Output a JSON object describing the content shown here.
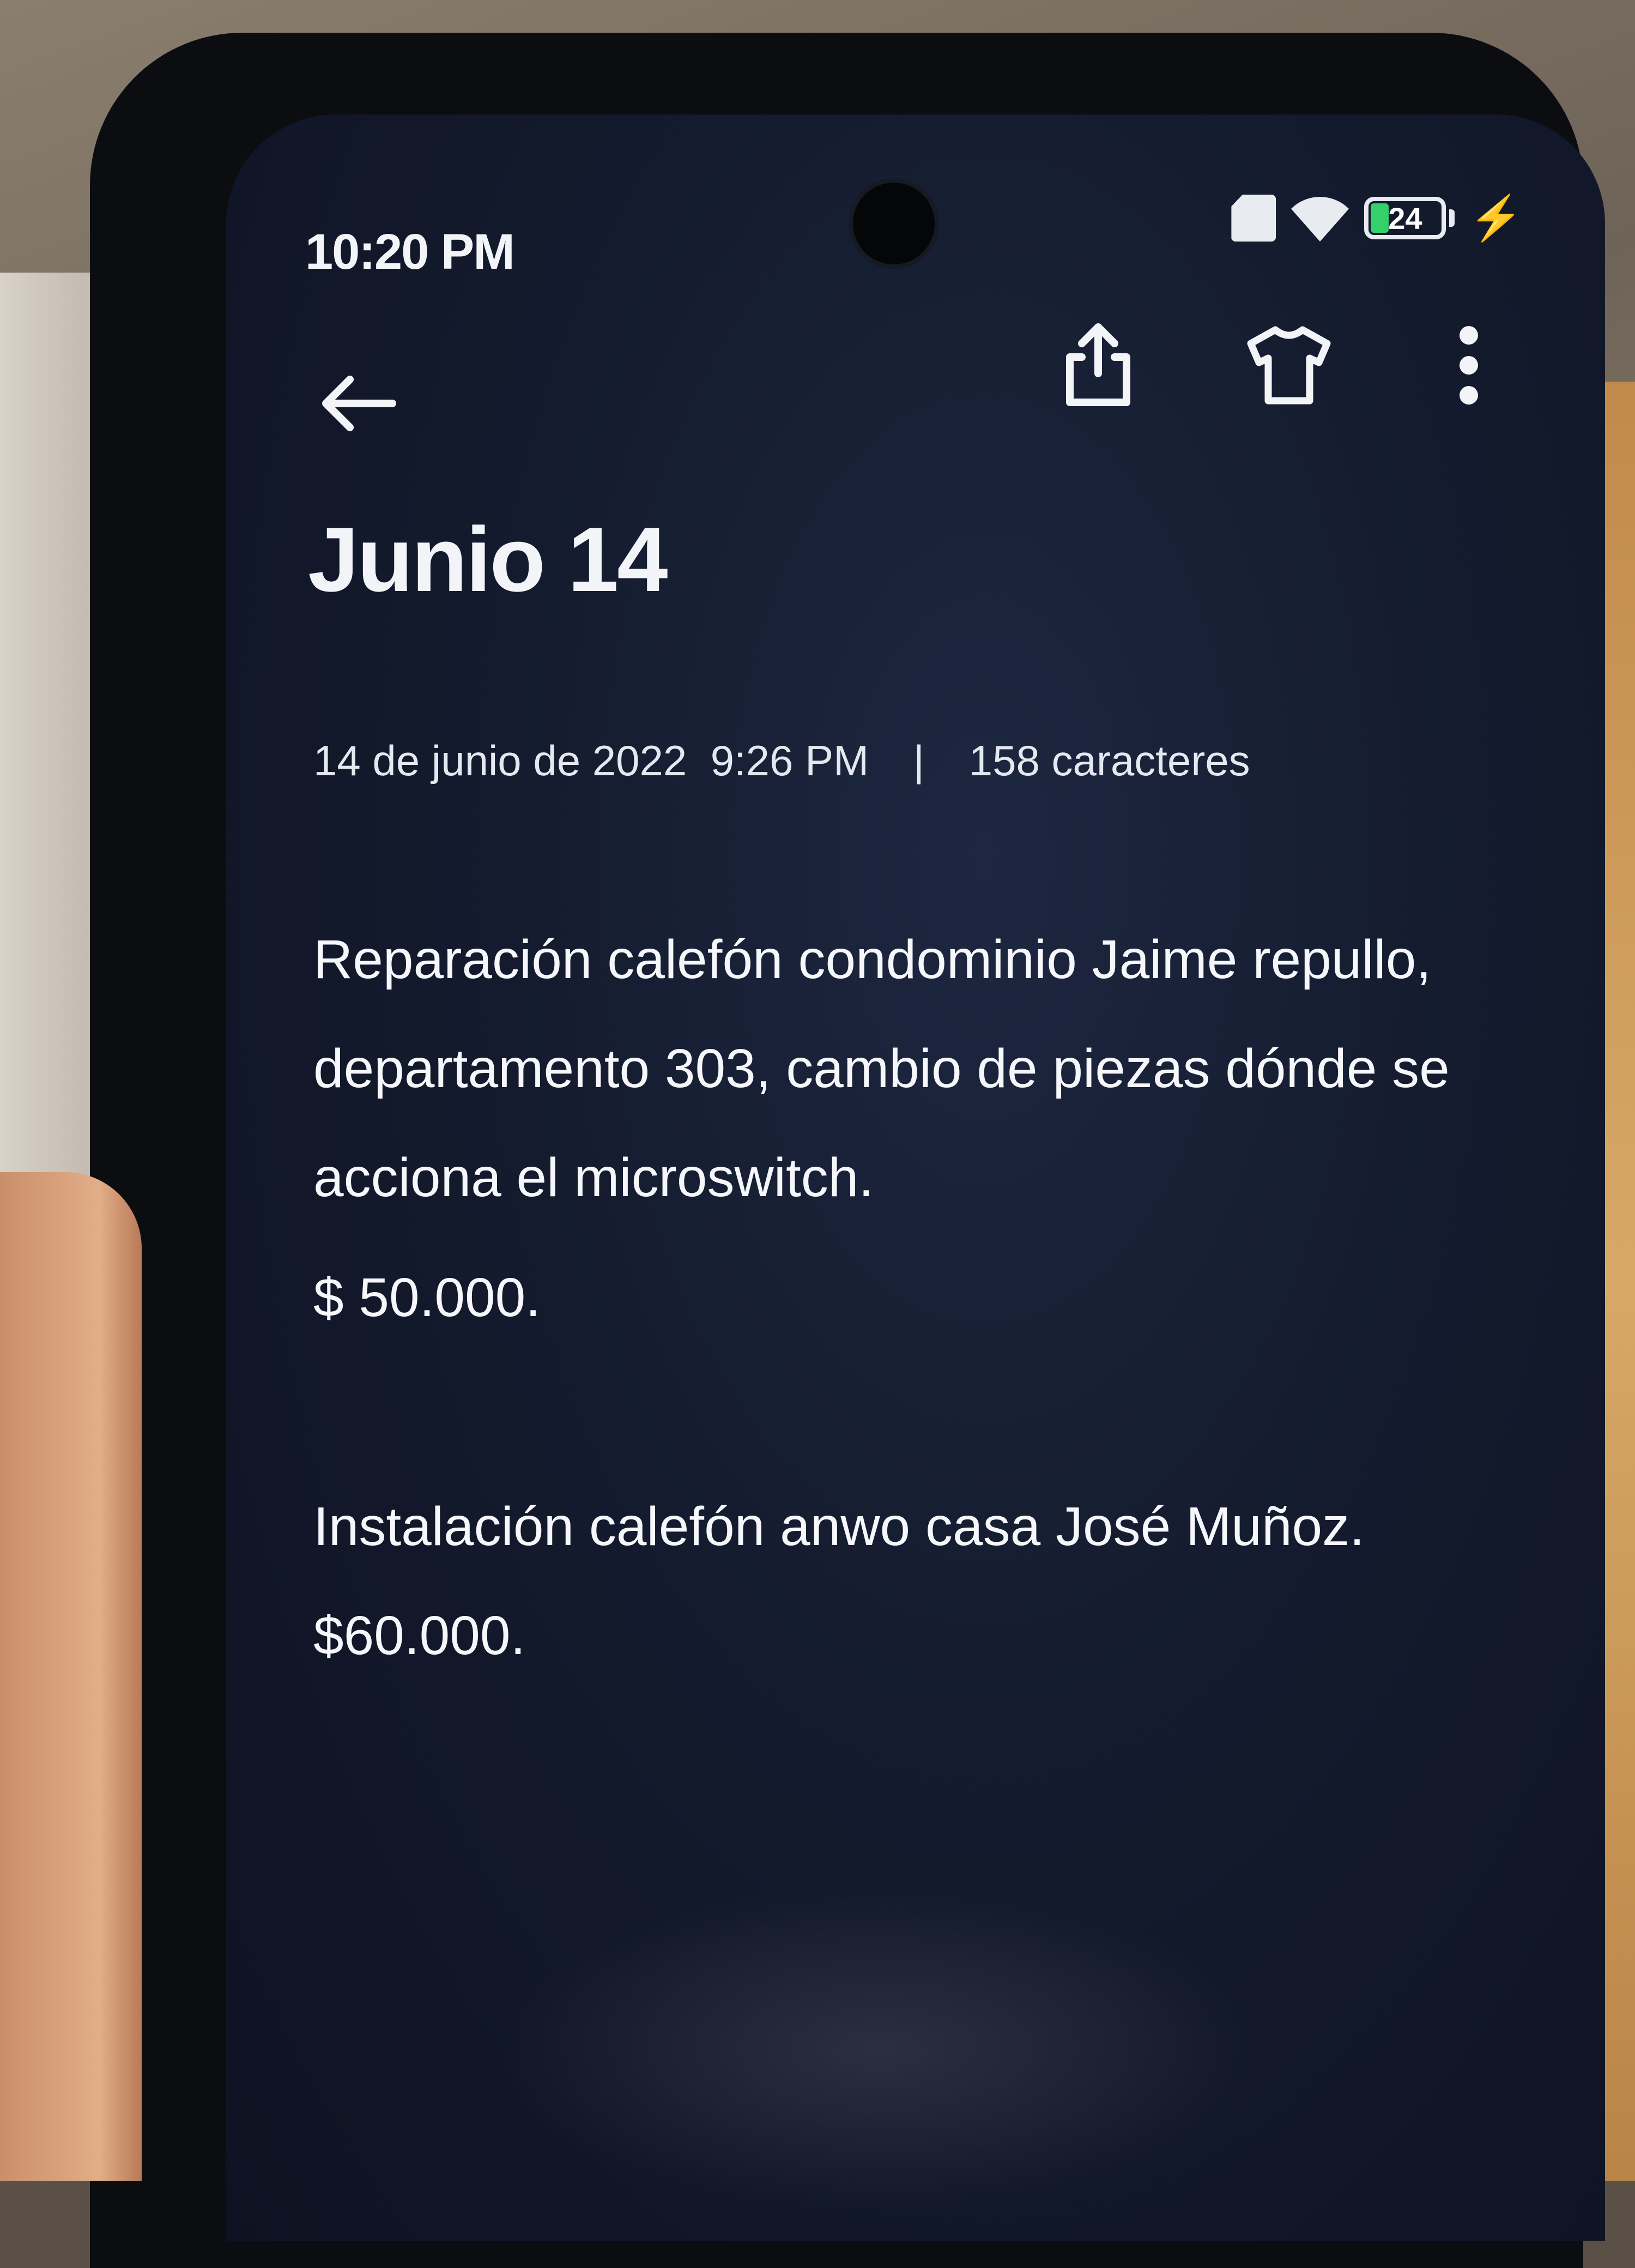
{
  "status_bar": {
    "time": "10:20 PM",
    "battery_level": "24",
    "battery_fraction": 0.24,
    "icons": [
      "sim-icon",
      "wifi-icon",
      "battery-icon",
      "charging-bolt-icon"
    ]
  },
  "toolbar": {
    "icons": [
      "back-arrow-icon",
      "share-icon",
      "theme-shirt-icon",
      "more-vertical-icon"
    ]
  },
  "note": {
    "title": "Junio 14",
    "meta": {
      "date_time": "14 de junio de 2022  9:26 PM",
      "separator": "|",
      "char_count": "158 caracteres"
    },
    "paragraphs": [
      "Reparación calefón condominio Jaime repullo, departamento 303, cambio de piezas dónde se acciona el microswitch.",
      "$ 50.000.",
      "Instalación calefón anwo casa José Muñoz.",
      "$60.000."
    ]
  },
  "colors": {
    "screen_background": "#141b2e",
    "text": "#f2f4f8",
    "battery_fill": "#34d06a"
  }
}
